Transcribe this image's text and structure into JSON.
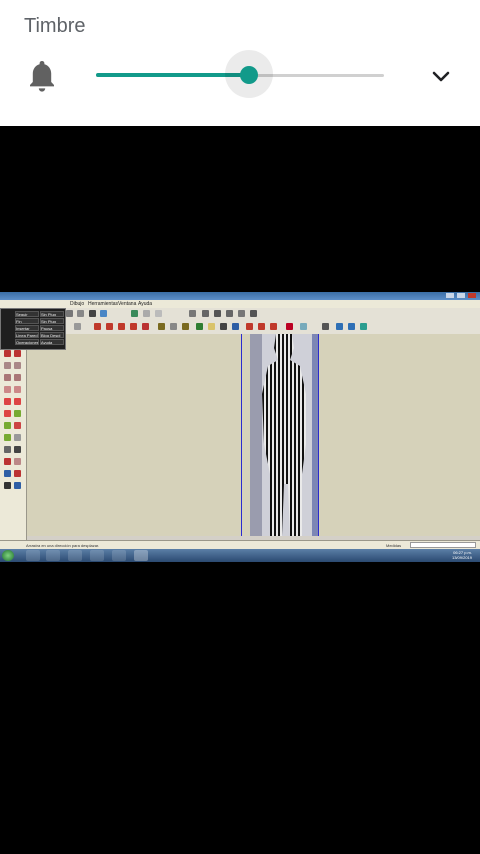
{
  "volume_panel": {
    "title": "Timbre",
    "level": 0.53,
    "icon": "bell-icon",
    "expand_icon": "chevron-down-icon",
    "accent": "#129a8a"
  },
  "video_capture": {
    "menu_items": [
      "Dibujo",
      "Herramientas",
      "Ventana",
      "Ayuda"
    ],
    "floating_panel": [
      "Seguir",
      "Sin Plug",
      "Fin",
      "Sin Plug",
      "Insertar",
      "Pausa",
      "Linea Pared",
      "Bloq Despl",
      "Operaciones",
      "Ayuda"
    ],
    "status_message": "Arrastra en una dirección para desplazar.",
    "measure_label": "Medidas",
    "clock_time": "06:27 p.m.",
    "clock_date": "13/09/2019"
  }
}
